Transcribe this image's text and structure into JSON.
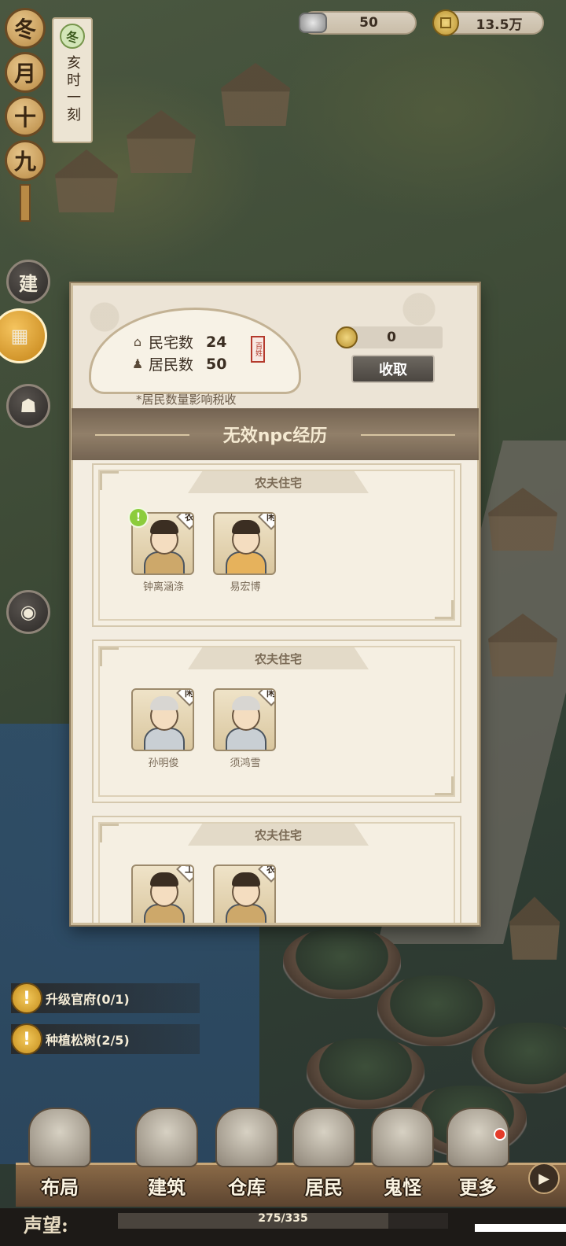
{
  "resources": {
    "silver": {
      "value": "50",
      "icon": "silver-ingot-icon"
    },
    "coins": {
      "value": "13.5万",
      "icon": "copper-coin-icon"
    }
  },
  "calendar": {
    "date_chars": [
      "冬",
      "月",
      "十",
      "九"
    ],
    "season_badge": "冬",
    "time": "亥时一刻"
  },
  "side_buttons": {
    "build": "建",
    "camera_icon": "camera-icon"
  },
  "modal": {
    "housing_label": "民宅数",
    "housing_count": "24",
    "resident_label": "居民数",
    "resident_count": "50",
    "seal_text": "百姓",
    "note": "*居民数量影响税收",
    "tax_amount": "0",
    "collect_button": "收取",
    "banner": "无效npc经历"
  },
  "houses": [
    {
      "title": "农夫住宅",
      "residents": [
        {
          "name": "钟离涵涤",
          "tag": "农",
          "alert": true,
          "style": "farmer"
        },
        {
          "name": "易宏博",
          "tag": "闲",
          "alert": false,
          "style": "girl"
        }
      ]
    },
    {
      "title": "农夫住宅",
      "residents": [
        {
          "name": "孙明俊",
          "tag": "闲",
          "alert": false,
          "style": "elder"
        },
        {
          "name": "须鸿雪",
          "tag": "闲",
          "alert": false,
          "style": "elder"
        }
      ]
    },
    {
      "title": "农夫住宅",
      "residents": [
        {
          "name": "",
          "tag": "工",
          "alert": false,
          "style": "farmer"
        },
        {
          "name": "",
          "tag": "农",
          "alert": false,
          "style": "farmer"
        }
      ]
    }
  ],
  "quests": [
    {
      "icon": "!",
      "text": "升级官府(0/1)"
    },
    {
      "icon": "!",
      "text": "种植松树(2/5)"
    }
  ],
  "nav": [
    {
      "label": "布局",
      "icon": "layout-icon"
    },
    {
      "label": "建筑",
      "icon": "building-icon"
    },
    {
      "label": "仓库",
      "icon": "warehouse-icon"
    },
    {
      "label": "居民",
      "icon": "residents-icon"
    },
    {
      "label": "鬼怪",
      "icon": "ghost-icon"
    },
    {
      "label": "更多",
      "icon": "more-icon"
    }
  ],
  "reputation": {
    "label": "声望:",
    "value": "275/335",
    "fraction": 0.82
  }
}
